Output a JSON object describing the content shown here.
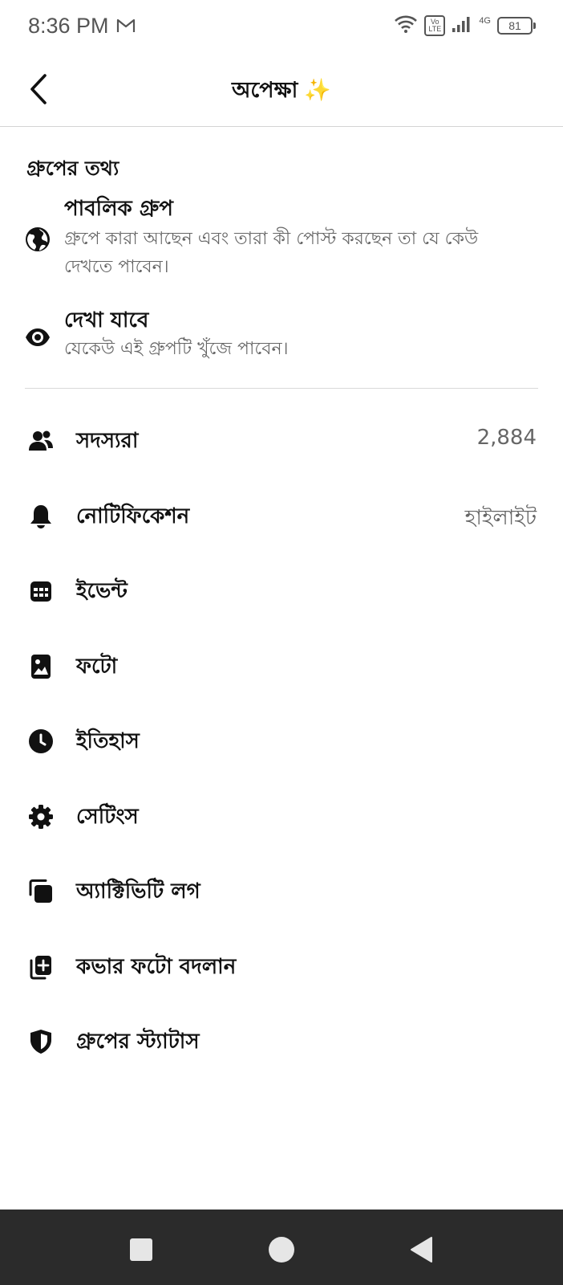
{
  "status_bar": {
    "time": "8:36 PM",
    "volte_label": "Vo LTE",
    "network": "4G",
    "battery": "81"
  },
  "header": {
    "title": "অপেক্ষা",
    "sparkle": "✨"
  },
  "group_info": {
    "section_title": "গ্রুপের তথ্য",
    "privacy": {
      "title": "পাবলিক গ্রুপ",
      "description": "গ্রুপে কারা আছেন এবং তারা কী পোস্ট করছেন তা যে কেউ দেখতে পাবেন।",
      "icon": "globe-icon"
    },
    "visibility": {
      "title": "দেখা যাবে",
      "description": "যেকেউ এই গ্রুপটি খুঁজে পাবেন।",
      "icon": "eye-icon"
    }
  },
  "menu": [
    {
      "label": "সদস্যরা",
      "value": "2,884",
      "icon": "members-icon"
    },
    {
      "label": "নোটিফিকেশন",
      "value": "হাইলাইট",
      "icon": "bell-icon"
    },
    {
      "label": "ইভেন্ট",
      "value": "",
      "icon": "calendar-icon"
    },
    {
      "label": "ফটো",
      "value": "",
      "icon": "photo-icon"
    },
    {
      "label": "ইতিহাস",
      "value": "",
      "icon": "clock-icon"
    },
    {
      "label": "সেটিংস",
      "value": "",
      "icon": "gear-icon"
    },
    {
      "label": "অ্যাক্টিভিটি লগ",
      "value": "",
      "icon": "activity-log-icon"
    },
    {
      "label": "কভার ফটো বদলান",
      "value": "",
      "icon": "add-cover-photo-icon"
    },
    {
      "label": "গ্রুপের স্ট্যাটাস",
      "value": "",
      "icon": "shield-icon"
    }
  ],
  "colors": {
    "text": "#111111",
    "secondary_text": "#666666",
    "navbar": "#2b2b2b",
    "sparkle": "#f5c518"
  }
}
